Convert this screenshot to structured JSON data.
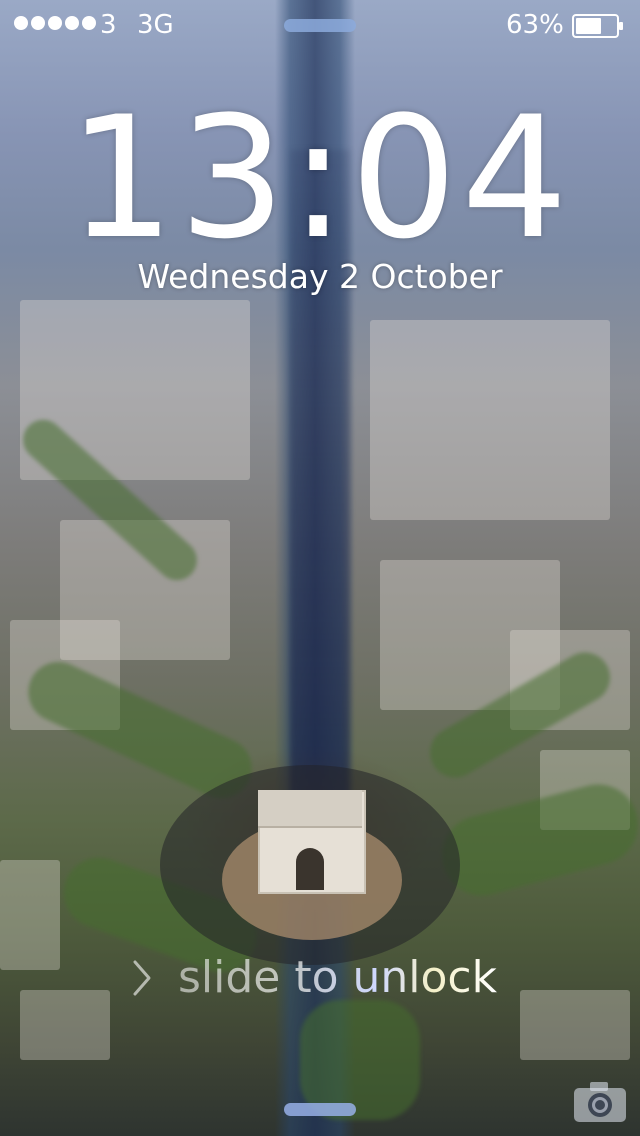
{
  "status_bar": {
    "signal_bars": 5,
    "carrier": "3",
    "network": "3G",
    "battery_percent": "63%",
    "battery_level": 0.63
  },
  "lock_screen": {
    "time": "13:04",
    "date": "Wednesday 2 October",
    "slide_to_unlock": "slide to unlock"
  },
  "icons": {
    "signal": "signal-dots-icon",
    "battery": "battery-icon",
    "chevron": "chevron-right-icon",
    "camera": "camera-icon",
    "grabber_top": "notification-center-grabber",
    "grabber_bottom": "control-center-grabber"
  },
  "colors": {
    "text": "#ffffff",
    "grabber": "#8caadc",
    "battery_fill": "#ffffff"
  }
}
